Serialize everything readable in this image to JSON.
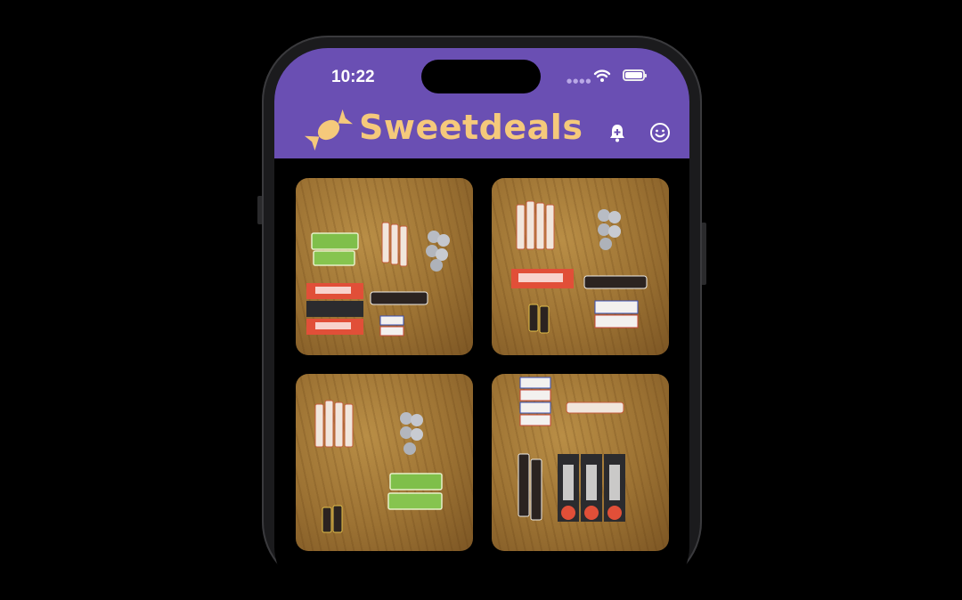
{
  "status_bar": {
    "time": "10:22",
    "signal_icon": "cellular-signal-icon",
    "wifi_icon": "wifi-icon",
    "battery_icon": "battery-icon"
  },
  "header": {
    "title": "Sweetdeals",
    "logo_icon": "wrapped-candy-icon",
    "actions": [
      {
        "icon": "bell-add-icon"
      },
      {
        "icon": "smiley-face-icon"
      }
    ]
  },
  "colors": {
    "header_bg": "#6a4fb3",
    "title": "#f5c97b",
    "screen_bg": "#000000"
  },
  "listings": [
    {
      "image": "candy assortment photo 1"
    },
    {
      "image": "candy assortment photo 2"
    },
    {
      "image": "candy assortment photo 3"
    },
    {
      "image": "candy assortment photo 4"
    }
  ]
}
